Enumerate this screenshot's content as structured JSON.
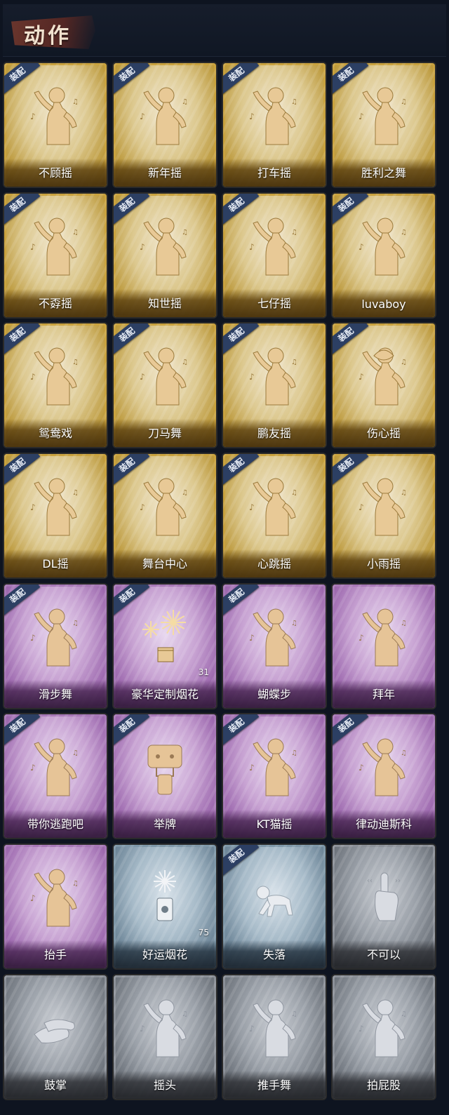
{
  "header": {
    "title": "动作"
  },
  "cards": [
    {
      "name": "不顾摇",
      "rarity": "gold",
      "equipped": true,
      "equipped_label": "装配",
      "icon": "dance-figure-icon"
    },
    {
      "name": "新年摇",
      "rarity": "gold",
      "equipped": true,
      "equipped_label": "装配",
      "icon": "dance-figure-icon"
    },
    {
      "name": "打车摇",
      "rarity": "gold",
      "equipped": true,
      "equipped_label": "装配",
      "icon": "dance-figure-icon"
    },
    {
      "name": "胜利之舞",
      "rarity": "gold",
      "equipped": true,
      "equipped_label": "装配",
      "icon": "dance-figure-icon"
    },
    {
      "name": "不孬摇",
      "rarity": "gold",
      "equipped": true,
      "equipped_label": "装配",
      "icon": "dance-figure-icon"
    },
    {
      "name": "知世摇",
      "rarity": "gold",
      "equipped": true,
      "equipped_label": "装配",
      "icon": "dance-figure-icon"
    },
    {
      "name": "七仔摇",
      "rarity": "gold",
      "equipped": true,
      "equipped_label": "装配",
      "icon": "dance-figure-icon"
    },
    {
      "name": "luvaboy",
      "rarity": "gold",
      "equipped": true,
      "equipped_label": "装配",
      "icon": "dance-figure-icon"
    },
    {
      "name": "鸳鸯戏",
      "rarity": "gold",
      "equipped": true,
      "equipped_label": "装配",
      "icon": "dance-figure-icon"
    },
    {
      "name": "刀马舞",
      "rarity": "gold",
      "equipped": true,
      "equipped_label": "装配",
      "icon": "dance-figure-icon"
    },
    {
      "name": "鹏友摇",
      "rarity": "gold",
      "equipped": true,
      "equipped_label": "装配",
      "icon": "dance-figure-icon"
    },
    {
      "name": "伤心摇",
      "rarity": "gold",
      "equipped": true,
      "equipped_label": "装配",
      "icon": "heart-hands-figure-icon"
    },
    {
      "name": "DL摇",
      "rarity": "gold",
      "equipped": true,
      "equipped_label": "装配",
      "icon": "dance-figure-icon"
    },
    {
      "name": "舞台中心",
      "rarity": "gold",
      "equipped": true,
      "equipped_label": "装配",
      "icon": "dance-figure-icon"
    },
    {
      "name": "心跳摇",
      "rarity": "gold",
      "equipped": true,
      "equipped_label": "装配",
      "icon": "dance-figure-icon"
    },
    {
      "name": "小雨摇",
      "rarity": "gold",
      "equipped": true,
      "equipped_label": "装配",
      "icon": "dance-figure-icon"
    },
    {
      "name": "滑步舞",
      "rarity": "purple",
      "equipped": true,
      "equipped_label": "装配",
      "icon": "dance-figure-icon"
    },
    {
      "name": "豪华定制烟花",
      "rarity": "purple",
      "equipped": true,
      "equipped_label": "装配",
      "icon": "fireworks-icon",
      "count": "31"
    },
    {
      "name": "蝴蝶步",
      "rarity": "purple",
      "equipped": true,
      "equipped_label": "装配",
      "icon": "dance-figure-icon"
    },
    {
      "name": "拜年",
      "rarity": "purple",
      "equipped": false,
      "icon": "greeting-figure-icon"
    },
    {
      "name": "带你逃跑吧",
      "rarity": "purple",
      "equipped": true,
      "equipped_label": "装配",
      "icon": "dance-figure-icon"
    },
    {
      "name": "举牌",
      "rarity": "purple",
      "equipped": true,
      "equipped_label": "装配",
      "icon": "sign-figure-icon"
    },
    {
      "name": "KT猫摇",
      "rarity": "purple",
      "equipped": true,
      "equipped_label": "装配",
      "icon": "dance-figure-icon"
    },
    {
      "name": "律动迪斯科",
      "rarity": "purple",
      "equipped": true,
      "equipped_label": "装配",
      "icon": "disco-figure-icon"
    },
    {
      "name": "抬手",
      "rarity": "purple",
      "equipped": false,
      "icon": "raise-hand-figure-icon"
    },
    {
      "name": "好运烟花",
      "rarity": "blue",
      "equipped": false,
      "icon": "firework-tube-icon",
      "count": "75"
    },
    {
      "name": "失落",
      "rarity": "blue",
      "equipped": true,
      "equipped_label": "装配",
      "icon": "crawling-figure-icon"
    },
    {
      "name": "不可以",
      "rarity": "gray",
      "equipped": false,
      "icon": "finger-no-icon"
    },
    {
      "name": "鼓掌",
      "rarity": "gray",
      "equipped": false,
      "icon": "clapping-hands-icon"
    },
    {
      "name": "摇头",
      "rarity": "gray",
      "equipped": false,
      "icon": "shake-head-figure-icon"
    },
    {
      "name": "推手舞",
      "rarity": "gray",
      "equipped": false,
      "icon": "push-hands-figure-icon"
    },
    {
      "name": "拍屁股",
      "rarity": "gray",
      "equipped": false,
      "icon": "spank-figure-icon"
    }
  ]
}
